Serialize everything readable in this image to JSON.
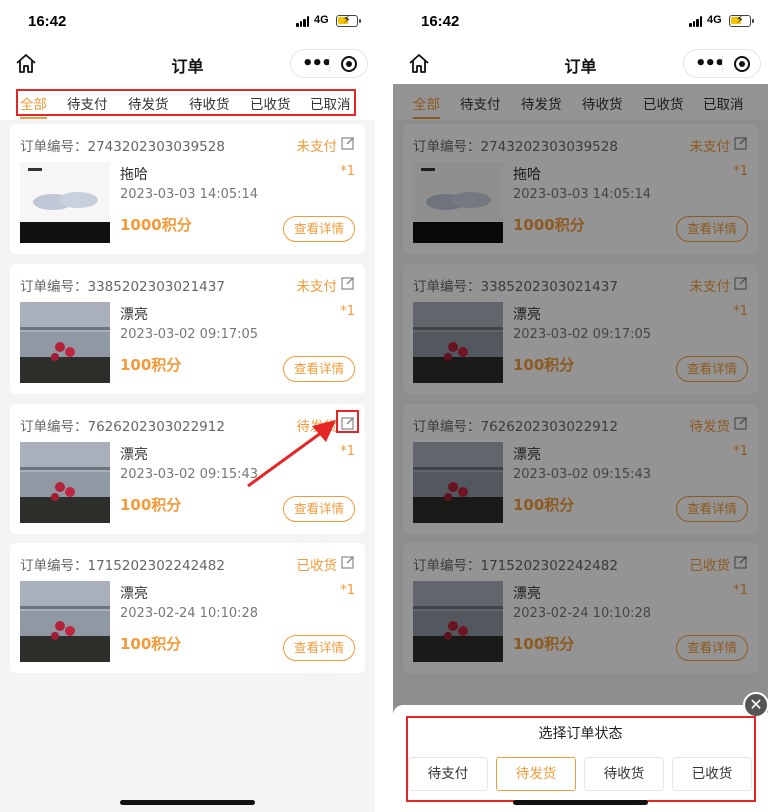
{
  "status_bar": {
    "time": "16:42",
    "network": "4G"
  },
  "navbar": {
    "title": "订单"
  },
  "tabs": [
    {
      "label": "全部",
      "active": true
    },
    {
      "label": "待支付",
      "active": false
    },
    {
      "label": "待发货",
      "active": false
    },
    {
      "label": "待收货",
      "active": false
    },
    {
      "label": "已收货",
      "active": false
    },
    {
      "label": "已取消",
      "active": false
    }
  ],
  "orders": [
    {
      "order_label": "订单编号：",
      "order_no": "2743202303039528",
      "status": "未支付",
      "product": "拖哈",
      "qty": "*1",
      "date": "2023-03-03 14:05:14",
      "points": "1000积分",
      "detail": "查看详情"
    },
    {
      "order_label": "订单编号：",
      "order_no": "3385202303021437",
      "status": "未支付",
      "product": "漂亮",
      "qty": "*1",
      "date": "2023-03-02 09:17:05",
      "points": "100积分",
      "detail": "查看详情"
    },
    {
      "order_label": "订单编号：",
      "order_no": "7626202303022912",
      "status": "待发货",
      "product": "漂亮",
      "qty": "*1",
      "date": "2023-03-02 09:15:43",
      "points": "100积分",
      "detail": "查看详情"
    },
    {
      "order_label": "订单编号：",
      "order_no": "1715202302242482",
      "status": "已收货",
      "product": "漂亮",
      "qty": "*1",
      "date": "2023-02-24 10:10:28",
      "points": "100积分",
      "detail": "查看详情"
    }
  ],
  "status_sheet": {
    "title": "选择订单状态",
    "options": [
      "待支付",
      "待发货",
      "待收货",
      "已收货"
    ],
    "selected": "待发货"
  },
  "colors": {
    "accent": "#f39b3a",
    "annotation": "#e52626"
  }
}
